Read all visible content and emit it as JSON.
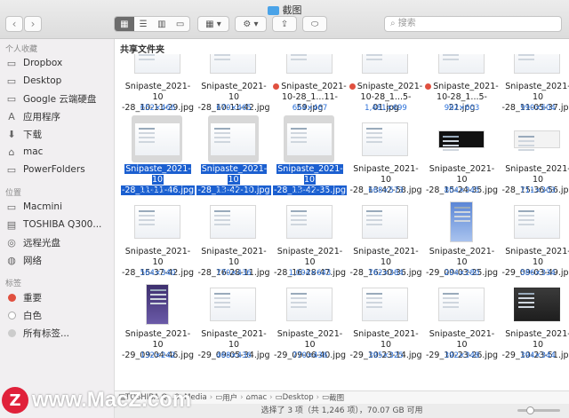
{
  "window": {
    "title": "截图"
  },
  "toolbar": {
    "back": "‹",
    "forward": "›",
    "view_icons": [
      "grid-view-icon",
      "list-view-icon",
      "column-view-icon",
      "gallery-view-icon"
    ],
    "group_icon": "group-icon",
    "action_icon": "gear-icon",
    "share_icon": "share-icon",
    "tag_icon": "tag-icon",
    "search_placeholder": "搜索"
  },
  "sidebar": {
    "favorites_header": "个人收藏",
    "favorites": [
      {
        "label": "Dropbox",
        "icon": "folder-icon"
      },
      {
        "label": "Desktop",
        "icon": "folder-icon"
      },
      {
        "label": "Google 云端硬盘",
        "icon": "folder-icon"
      },
      {
        "label": "应用程序",
        "icon": "applications-icon"
      },
      {
        "label": "下载",
        "icon": "download-icon"
      },
      {
        "label": "mac",
        "icon": "home-icon"
      },
      {
        "label": "PowerFolders",
        "icon": "folder-icon"
      }
    ],
    "locations_header": "位置",
    "locations": [
      {
        "label": "Macmini",
        "icon": "computer-icon"
      },
      {
        "label": "TOSHIBA Q300...",
        "icon": "disk-icon"
      },
      {
        "label": "远程光盘",
        "icon": "optical-disc-icon"
      },
      {
        "label": "网络",
        "icon": "network-icon"
      }
    ],
    "tags_header": "标签",
    "tags": [
      {
        "label": "重要",
        "color": "#e0503f"
      },
      {
        "label": "白色",
        "color": "#ffffff"
      },
      {
        "label": "所有标签...",
        "color": "#cccccc"
      }
    ]
  },
  "main": {
    "group_header": "共享文件夹",
    "files": [
      {
        "l1": "Snipaste_2021-10",
        "l2": "-28_10-11-29.jpg",
        "dim": "652×466",
        "tag": false,
        "sel": false,
        "kind": "win"
      },
      {
        "l1": "Snipaste_2021-10",
        "l2": "-28_10-11-42.jpg",
        "dim": "670×465",
        "tag": false,
        "sel": false,
        "kind": "win"
      },
      {
        "l1": "Snipaste_2021-",
        "l2": "10-28_1...11-59.jpg",
        "dim": "664×467",
        "tag": true,
        "sel": false,
        "kind": "win"
      },
      {
        "l1": "Snipaste_2021-",
        "l2": "10-28_1...5-01.jpg",
        "dim": "1,481×699",
        "tag": true,
        "sel": false,
        "kind": "win"
      },
      {
        "l1": "Snipaste_2021-",
        "l2": "10-28_1...5-21.jpg",
        "dim": "992×603",
        "tag": true,
        "sel": false,
        "kind": "win"
      },
      {
        "l1": "Snipaste_2021-10",
        "l2": "-28_11-05-37.jpg",
        "dim": "990×604",
        "tag": false,
        "sel": false,
        "kind": "win"
      },
      {
        "l1": "Snipaste_2021-10",
        "l2": "-28_11-11-46.jpg",
        "dim": "981×591",
        "tag": false,
        "sel": true,
        "kind": "win"
      },
      {
        "l1": "Snipaste_2021-10",
        "l2": "-28_13-42-10.jpg",
        "dim": "668×598",
        "tag": false,
        "sel": true,
        "kind": "win"
      },
      {
        "l1": "Snipaste_2021-10",
        "l2": "-28_13-42-35.jpg",
        "dim": "668×573",
        "tag": false,
        "sel": true,
        "kind": "win"
      },
      {
        "l1": "Snipaste_2021-10",
        "l2": "-28_13-42-58.jpg",
        "dim": "668×573",
        "tag": false,
        "sel": false,
        "kind": "win"
      },
      {
        "l1": "Snipaste_2021-10",
        "l2": "-28_15-24-35.jpg",
        "dim": "804×345",
        "tag": false,
        "sel": false,
        "kind": "kb"
      },
      {
        "l1": "Snipaste_2021-10",
        "l2": "-28_15-36-56.jpg",
        "dim": "711×303",
        "tag": false,
        "sel": false,
        "kind": "kbw"
      },
      {
        "l1": "Snipaste_2021-10",
        "l2": "-28_15-37-42.jpg",
        "dim": "564×340",
        "tag": false,
        "sel": false,
        "kind": "win"
      },
      {
        "l1": "Snipaste_2021-10",
        "l2": "-28_16-28-11.jpg",
        "dim": "770×436",
        "tag": false,
        "sel": false,
        "kind": "win"
      },
      {
        "l1": "Snipaste_2021-10",
        "l2": "-28_16-28-47.jpg",
        "dim": "1,004×643",
        "tag": false,
        "sel": false,
        "kind": "win"
      },
      {
        "l1": "Snipaste_2021-10",
        "l2": "-28_16-30-36.jpg",
        "dim": "762×384",
        "tag": false,
        "sel": false,
        "kind": "win"
      },
      {
        "l1": "Snipaste_2021-10",
        "l2": "-29_09-03-25.jpg",
        "dim": "204×280",
        "tag": false,
        "sel": false,
        "kind": "phone"
      },
      {
        "l1": "Snipaste_2021-10",
        "l2": "-29_09-03-49.jpg",
        "dim": "586×334",
        "tag": false,
        "sel": false,
        "kind": "win"
      },
      {
        "l1": "Snipaste_2021-10",
        "l2": "-29_09-04-46.jpg",
        "dim": "132×242",
        "tag": false,
        "sel": false,
        "kind": "purple"
      },
      {
        "l1": "Snipaste_2021-10",
        "l2": "-29_09-05-34.jpg",
        "dim": "468×436",
        "tag": false,
        "sel": false,
        "kind": "win"
      },
      {
        "l1": "Snipaste_2021-10",
        "l2": "-29_09-06-40.jpg",
        "dim": "770×436",
        "tag": false,
        "sel": false,
        "kind": "win"
      },
      {
        "l1": "Snipaste_2021-10",
        "l2": "-29_10-23-14.jpg",
        "dim": "395×325",
        "tag": false,
        "sel": false,
        "kind": "win"
      },
      {
        "l1": "Snipaste_2021-10",
        "l2": "-29_10-23-26.jpg",
        "dim": "392×348",
        "tag": false,
        "sel": false,
        "kind": "win"
      },
      {
        "l1": "Snipaste_2021-10",
        "l2": "-29_10-23-51.jpg",
        "dim": "394×344",
        "tag": false,
        "sel": false,
        "kind": "dark"
      }
    ]
  },
  "pathbar": {
    "items": [
      "TOSHIBA Q...0. Media",
      "用户",
      "mac",
      "Desktop",
      "截图"
    ]
  },
  "status": {
    "text": "选择了 3 项（共 1,246 项），70.07 GB 可用"
  },
  "watermark": {
    "logo": "Z",
    "text": "www.MacZ.com"
  }
}
